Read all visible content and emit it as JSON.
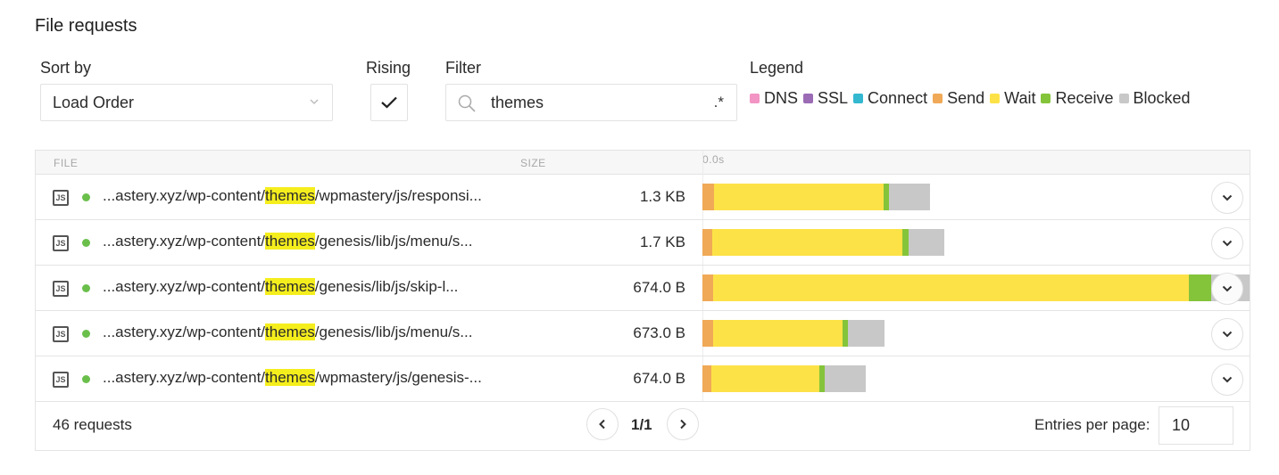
{
  "header": {
    "title": "File requests"
  },
  "controls": {
    "sort_label": "Sort by",
    "sort_value": "Load Order",
    "rising_label": "Rising",
    "rising_checked": true,
    "filter_label": "Filter",
    "filter_value": "themes",
    "regex_toggle": ".*",
    "legend_label": "Legend"
  },
  "legend": [
    {
      "name": "DNS",
      "color": "#f294c4"
    },
    {
      "name": "SSL",
      "color": "#9b6bb5"
    },
    {
      "name": "Connect",
      "color": "#33b8d0"
    },
    {
      "name": "Send",
      "color": "#f0a957"
    },
    {
      "name": "Wait",
      "color": "#fde247"
    },
    {
      "name": "Receive",
      "color": "#84c43a"
    },
    {
      "name": "Blocked",
      "color": "#c8c8c8"
    }
  ],
  "table": {
    "columns": {
      "file": "FILE",
      "size": "SIZE",
      "timeline_start": "0.0s"
    },
    "rows": [
      {
        "type": "JS",
        "status": "ok",
        "url_prefix": "...astery.xyz/wp-content/",
        "url_match": "themes",
        "url_suffix": "/wpmastery/js/responsi...",
        "size": "1.3 KB",
        "timing_fraction": {
          "send": [
            0.0,
            0.021
          ],
          "wait": [
            0.021,
            0.331
          ],
          "receive": [
            0.331,
            0.341
          ],
          "blocked": [
            0.341,
            0.416
          ]
        }
      },
      {
        "type": "JS",
        "status": "ok",
        "url_prefix": "...astery.xyz/wp-content/",
        "url_match": "themes",
        "url_suffix": "/genesis/lib/js/menu/s...",
        "size": "1.7 KB",
        "timing_fraction": {
          "send": [
            0.0,
            0.018
          ],
          "wait": [
            0.018,
            0.366
          ],
          "receive": [
            0.366,
            0.377
          ],
          "blocked": [
            0.377,
            0.442
          ]
        }
      },
      {
        "type": "JS",
        "status": "ok",
        "url_prefix": "...astery.xyz/wp-content/",
        "url_match": "themes",
        "url_suffix": "/genesis/lib/js/skip-l...",
        "size": "674.0 B",
        "timing_fraction": {
          "send": [
            0.0,
            0.02
          ],
          "wait": [
            0.02,
            0.889
          ],
          "receive": [
            0.889,
            0.93
          ],
          "blocked": [
            0.93,
            1.0
          ]
        }
      },
      {
        "type": "JS",
        "status": "ok",
        "url_prefix": "...astery.xyz/wp-content/",
        "url_match": "themes",
        "url_suffix": "/genesis/lib/js/menu/s...",
        "size": "673.0 B",
        "timing_fraction": {
          "send": [
            0.0,
            0.02
          ],
          "wait": [
            0.02,
            0.256
          ],
          "receive": [
            0.256,
            0.266
          ],
          "blocked": [
            0.266,
            0.333
          ]
        }
      },
      {
        "type": "JS",
        "status": "ok",
        "url_prefix": "...astery.xyz/wp-content/",
        "url_match": "themes",
        "url_suffix": "/wpmastery/js/genesis-...",
        "size": "674.0 B",
        "timing_fraction": {
          "send": [
            0.0,
            0.016
          ],
          "wait": [
            0.016,
            0.214
          ],
          "receive": [
            0.214,
            0.223
          ],
          "blocked": [
            0.223,
            0.299
          ]
        }
      }
    ]
  },
  "footer": {
    "count": "46 requests",
    "page": "1/1",
    "entries_label": "Entries per page:",
    "entries_value": "10"
  }
}
